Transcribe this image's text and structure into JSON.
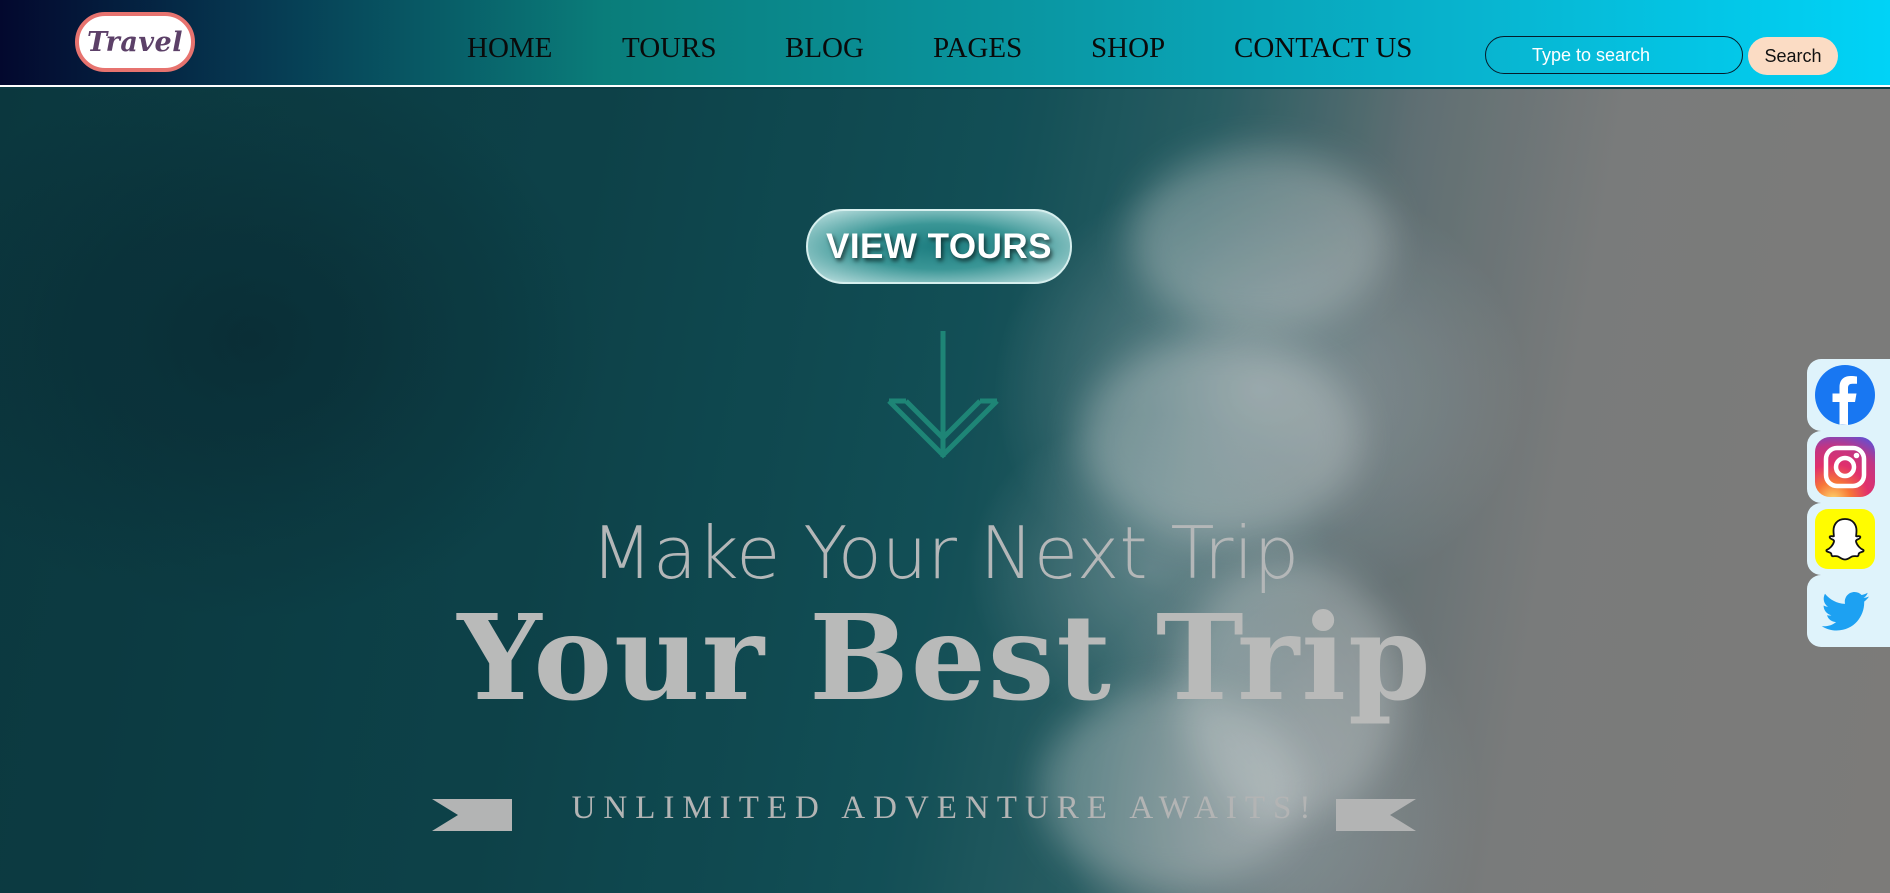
{
  "header": {
    "logo_text": "Travel",
    "nav": [
      {
        "label": "HOME",
        "name": "home"
      },
      {
        "label": "TOURS",
        "name": "tours"
      },
      {
        "label": "BLOG",
        "name": "blog"
      },
      {
        "label": "PAGES",
        "name": "pages"
      },
      {
        "label": "SHOP",
        "name": "shop"
      },
      {
        "label": "CONTACT US",
        "name": "contact-us"
      }
    ],
    "search": {
      "placeholder": "Type to search",
      "button_label": "Search"
    }
  },
  "hero": {
    "cta_label": "VIEW TOURS",
    "tagline": "Make Your Next Trip",
    "headline": "Your Best Trip",
    "subline": "UNLIMITED ADVENTURE AWAITS!"
  },
  "social": [
    {
      "name": "facebook",
      "icon": "facebook-icon"
    },
    {
      "name": "instagram",
      "icon": "instagram-icon"
    },
    {
      "name": "snapchat",
      "icon": "snapchat-icon"
    },
    {
      "name": "twitter",
      "icon": "twitter-icon"
    }
  ],
  "colors": {
    "logo_border": "#e7736f",
    "logo_text": "#5c4068",
    "search_button": "#fbdcc4",
    "arrow": "#1e8576",
    "social_bg": "#dff3fb",
    "facebook": "#1877f2",
    "snapchat": "#fffc00",
    "twitter": "#1da1f2"
  }
}
